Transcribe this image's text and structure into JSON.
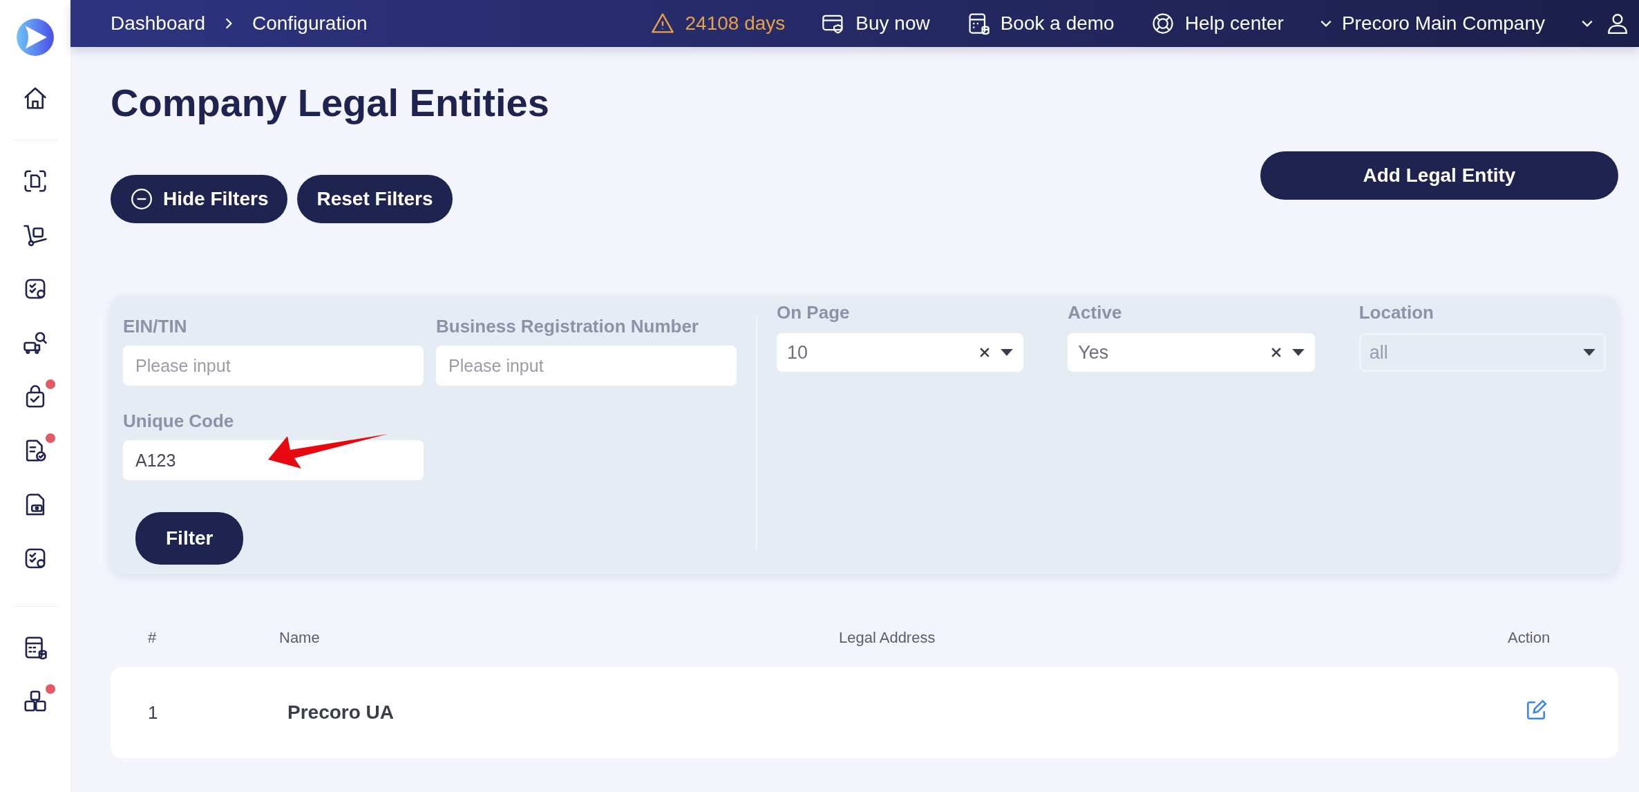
{
  "sidebar": {
    "items": [
      {
        "badge": false
      },
      {
        "badge": false
      },
      {
        "badge": false
      },
      {
        "badge": false
      },
      {
        "badge": false
      },
      {
        "badge": true
      },
      {
        "badge": true
      },
      {
        "badge": false
      },
      {
        "badge": false
      },
      {
        "badge": false
      },
      {
        "badge": true
      }
    ]
  },
  "topbar": {
    "breadcrumbs": [
      "Dashboard",
      "Configuration"
    ],
    "warning": "24108 days",
    "links": [
      "Buy now",
      "Book a demo",
      "Help center"
    ],
    "company": "Precoro Main Company"
  },
  "title": "Company Legal Entities",
  "buttons": {
    "hide_filters": "Hide Filters",
    "reset_filters": "Reset Filters",
    "add": "Add Legal Entity"
  },
  "filters": {
    "text_fields": [
      {
        "label": "EIN/TIN",
        "placeholder": "Please input"
      },
      {
        "label": "Business Registration Number",
        "placeholder": "Please input"
      },
      {
        "label": "Unique Code",
        "value": "A123"
      }
    ],
    "selects": [
      {
        "label": "On Page",
        "value": "10",
        "clearable": true,
        "disabled": false
      },
      {
        "label": "Active",
        "value": "Yes",
        "clearable": true,
        "disabled": false
      },
      {
        "label": "Location",
        "value": "all",
        "clearable": false,
        "disabled": true
      }
    ],
    "submit": "Filter"
  },
  "table": {
    "columns": [
      "#",
      "Name",
      "Legal Address",
      "Action"
    ],
    "rows": [
      {
        "index": "1",
        "name": "Precoro UA"
      }
    ]
  }
}
